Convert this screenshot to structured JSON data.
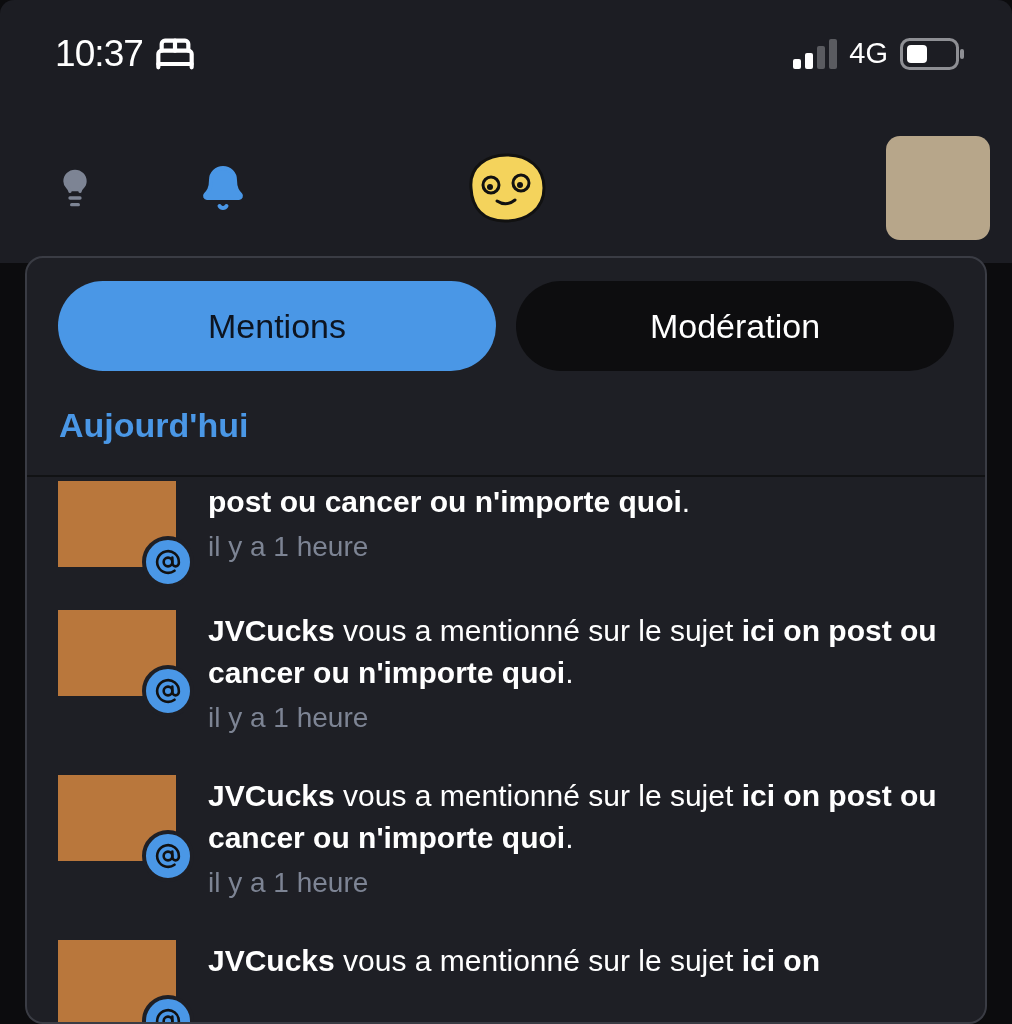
{
  "status_bar": {
    "time": "10:37",
    "network": "4G"
  },
  "tabs": [
    {
      "label": "Mentions",
      "selected": true
    },
    {
      "label": "Modération",
      "selected": false
    }
  ],
  "section_title": "Aujourd'hui",
  "notifications": [
    {
      "text": "**post ou cancer ou n'importe quoi**.",
      "time": "il y a 1 heure"
    },
    {
      "text": "**JVCucks** vous a mentionné sur le sujet **ici on post ou cancer ou n'importe quoi**.",
      "time": "il y a 1 heure"
    },
    {
      "text": "**JVCucks** vous a mentionné sur le sujet **ici on post ou cancer ou n'importe quoi**.",
      "time": "il y a 1 heure"
    },
    {
      "text": "**JVCucks** vous a mentionné sur le sujet **ici on**"
    }
  ]
}
